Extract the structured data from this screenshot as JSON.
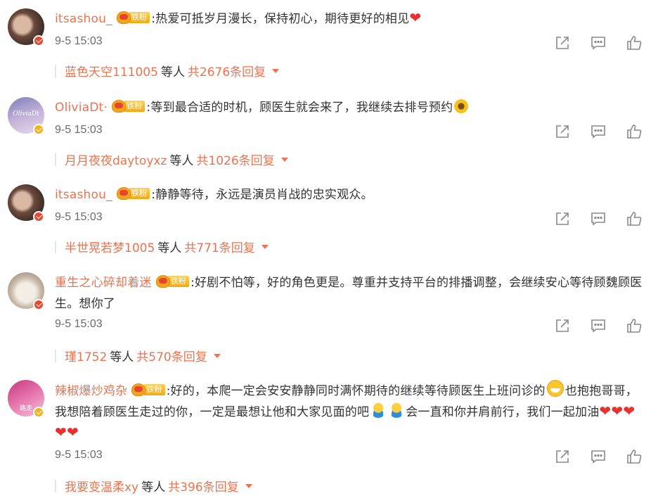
{
  "comments": [
    {
      "user": "itsashou_",
      "fan_label": "铁粉",
      "text": ":热爱可抵岁月漫长，保持初心，期待更好的相见",
      "time": "9-5 15:03",
      "reply_user": "蓝色天空111005",
      "reply_mid": "等人",
      "reply_count": "共2676条回复"
    },
    {
      "user": "OliviaDt·",
      "avatar_text": "OliviaDt",
      "fan_label": "铁粉",
      "text": ":等到最合适的时机，顾医生就会来了，我继续去排号预约",
      "time": "9-5 15:03",
      "reply_user": "月月夜夜daytoyxz",
      "reply_mid": "等人",
      "reply_count": "共1026条回复"
    },
    {
      "user": "itsashou_",
      "fan_label": "铁粉",
      "text": ":静静等待，永远是演员肖战的忠实观众。",
      "time": "9-5 15:03",
      "reply_user": "半世晃若梦1005",
      "reply_mid": "等人",
      "reply_count": "共771条回复"
    },
    {
      "user": "重生之心碎却着迷",
      "fan_label": "铁粉",
      "text": ":好剧不怕等，好的角色更是。尊重并支持平台的排播调整，会继续安心等待顾魏顾医生。想你了",
      "time": "9-5 15:03",
      "reply_user": "瑾1752",
      "reply_mid": "等人",
      "reply_count": "共570条回复"
    },
    {
      "user": "辣椒爆炒鸡杂",
      "avatar_text": "路走",
      "fan_label": "铁粉",
      "text_a": ":好的，本爬一定会安安静静同时满怀期待的继续等待顾医生上班问诊的",
      "text_b": "也抱抱哥哥，我想陪着顾医生走过的你，一定是最想让他和大家见面的吧",
      "text_c": "会一直和你并肩前行，我们一起加油",
      "time": "9-5 15:03",
      "reply_user": "我要变温柔xy",
      "reply_mid": "等人",
      "reply_count": "共396条回复"
    }
  ],
  "icons": {
    "share": "share-icon",
    "comment": "comment-icon",
    "like": "like-icon",
    "expand": "chevron-down-icon",
    "heart": "heart-icon"
  },
  "colors": {
    "accent": "#eb7350",
    "heart": "#e8312c",
    "fan_badge": "#f3a913"
  }
}
